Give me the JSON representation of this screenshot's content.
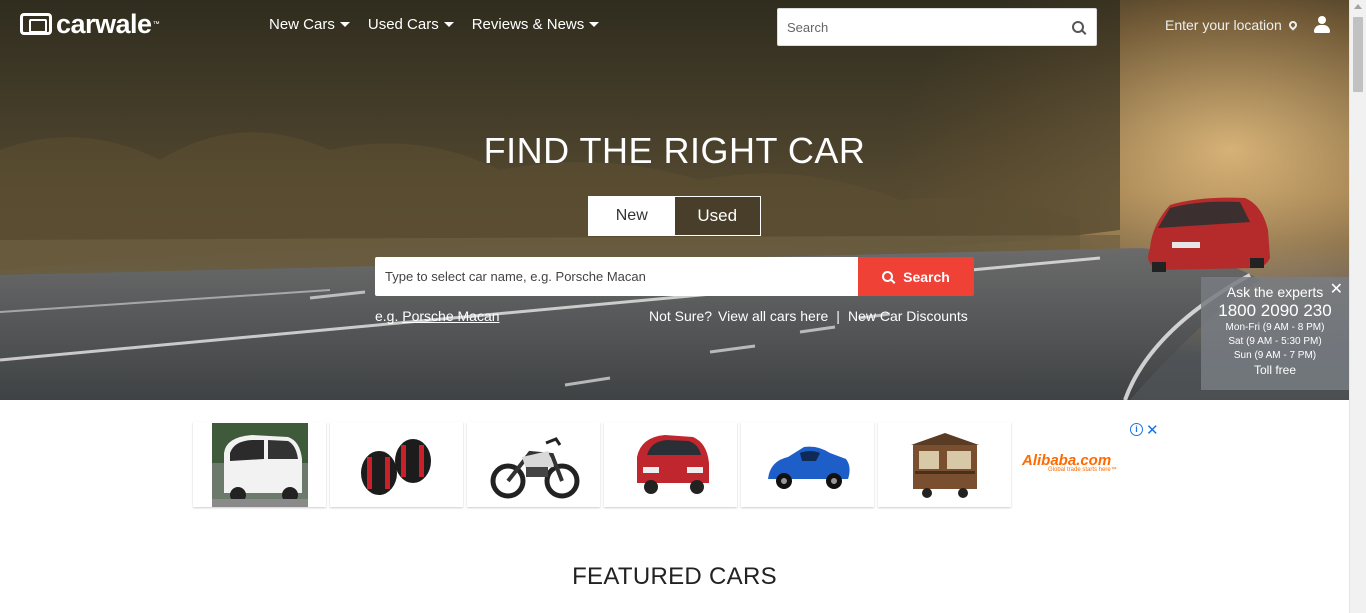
{
  "brand": {
    "logo_text": "carwale",
    "trademark": "™"
  },
  "nav": {
    "items": [
      {
        "label": "New Cars"
      },
      {
        "label": "Used Cars"
      },
      {
        "label": "Reviews & News"
      }
    ]
  },
  "header_search": {
    "placeholder": "Search"
  },
  "location": {
    "label": "Enter your location"
  },
  "hero": {
    "title": "FIND THE RIGHT CAR",
    "toggle": {
      "new": "New",
      "used": "Used",
      "selected": "New"
    },
    "search_placeholder": "Type to select car name, e.g. Porsche Macan",
    "search_button": "Search",
    "example_prefix": "e.g. ",
    "example_link": "Porsche Macan",
    "not_sure": "Not Sure?",
    "view_all": "View all cars here",
    "separator": "|",
    "discounts": "New Car Discounts"
  },
  "experts": {
    "title": "Ask the experts",
    "phone": "1800 2090 230",
    "hours": [
      "Mon-Fri (9 AM - 8 PM)",
      "Sat (9 AM - 5:30 PM)",
      "Sun (9 AM - 7 PM)"
    ],
    "toll": "Toll free"
  },
  "ads": {
    "items": [
      {
        "icon": "white-microcar-image"
      },
      {
        "icon": "dumbbell-image"
      },
      {
        "icon": "motorcycle-image"
      },
      {
        "icon": "red-hatchback-image"
      },
      {
        "icon": "blue-toy-car-image"
      },
      {
        "icon": "food-cart-image"
      }
    ],
    "advertiser": "Alibaba.com",
    "advertiser_tagline": "Global trade starts here™",
    "info_icon": "info-icon",
    "close_icon": "close-icon"
  },
  "featured": {
    "title": "FEATURED CARS"
  },
  "colors": {
    "accent": "#ef4136",
    "ad_link": "#1a73e8",
    "alibaba": "#ff6a00"
  }
}
